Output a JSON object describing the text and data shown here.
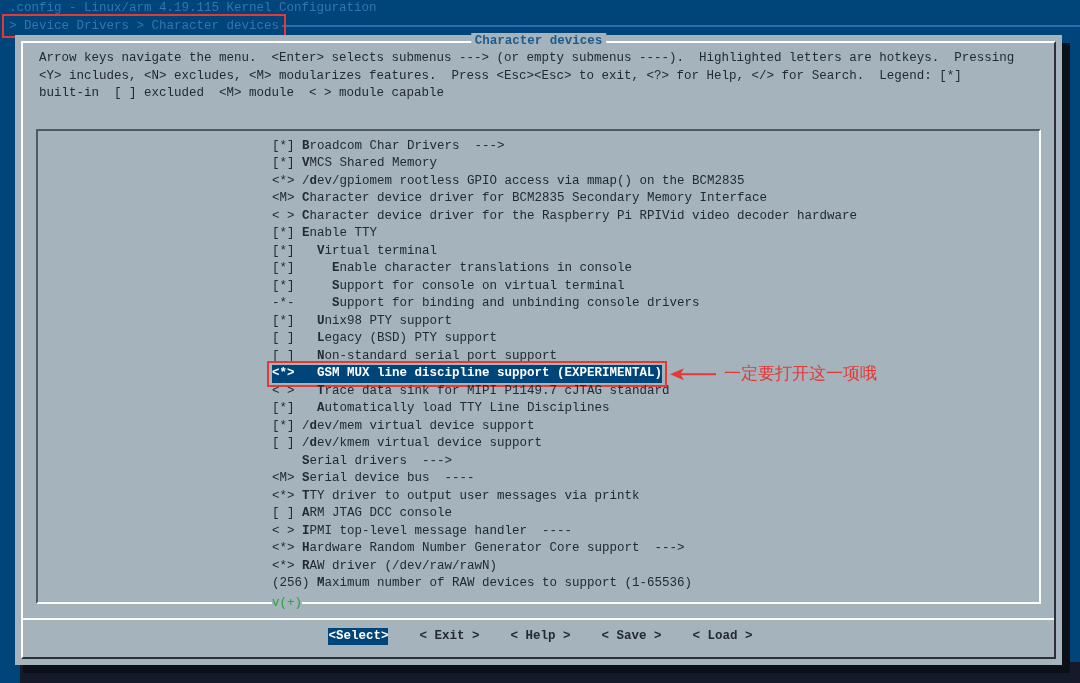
{
  "window": {
    "title": ".config - Linux/arm 4.19.115 Kernel Configuration"
  },
  "breadcrumb": "> Device Drivers > Character devices",
  "dialog": {
    "title": "Character devices",
    "help_lines": [
      "Arrow keys navigate the menu.  <Enter> selects submenus ---> (or empty submenus ----).  Highlighted letters are hotkeys.  Pressing",
      "<Y> includes, <N> excludes, <M> modularizes features.  Press <Esc><Esc> to exit, <?> for Help, </> for Search.  Legend: [*]",
      "built-in  [ ] excluded  <M> module  < > module capable"
    ],
    "items": [
      {
        "prefix": "[*]",
        "text": "**B**roadcom Char Drivers  --->",
        "selected": false
      },
      {
        "prefix": "[*]",
        "text": "**V**MCS Shared Memory",
        "selected": false
      },
      {
        "prefix": "<*>",
        "text": "/**d**ev/gpiomem rootless GPIO access via mmap() on the BCM2835",
        "selected": false
      },
      {
        "prefix": "<M>",
        "text": "**C**haracter device driver for BCM2835 Secondary Memory Interface",
        "selected": false
      },
      {
        "prefix": "< >",
        "text": "**C**haracter device driver for the Raspberry Pi RPIVid video decoder hardware",
        "selected": false
      },
      {
        "prefix": "[*]",
        "text": "**E**nable TTY",
        "selected": false,
        "children": [
          {
            "prefix": "[*]",
            "text": "**V**irtual terminal",
            "selected": false,
            "children": [
              {
                "prefix": "[*]",
                "text": "**E**nable character translations in console",
                "selected": false
              },
              {
                "prefix": "[*]",
                "text": "**S**upport for console on virtual terminal",
                "selected": false
              },
              {
                "prefix": "-*-",
                "text": "**S**upport for binding and unbinding console drivers",
                "selected": false
              }
            ]
          },
          {
            "prefix": "[*]",
            "text": "**U**nix98 PTY support",
            "selected": false
          },
          {
            "prefix": "[ ]",
            "text": "**L**egacy (BSD) PTY support",
            "selected": false
          },
          {
            "prefix": "[ ]",
            "text": "**N**on-standard serial port support",
            "selected": false
          },
          {
            "prefix": "<*>",
            "text": "**G**SM MUX line discipline support (EXPERIMENTAL)",
            "selected": true
          },
          {
            "prefix": "< >",
            "text": "**T**race data sink for MIPI P1149.7 cJTAG standard",
            "selected": false
          },
          {
            "prefix": "[*]",
            "text": "**A**utomatically load TTY Line Disciplines",
            "selected": false
          }
        ]
      },
      {
        "prefix": "[*]",
        "text": "/**d**ev/mem virtual device support",
        "selected": false
      },
      {
        "prefix": "[ ]",
        "text": "/**d**ev/kmem virtual device support",
        "selected": false
      },
      {
        "text": "**S**erial drivers  --->",
        "selected": false
      },
      {
        "prefix": "<M>",
        "text": "**S**erial device bus  ----",
        "selected": false
      },
      {
        "prefix": "<*>",
        "text": "**T**TY driver to output user messages via printk",
        "selected": false
      },
      {
        "prefix": "[ ]",
        "text": "**A**RM JTAG DCC console",
        "selected": false
      },
      {
        "prefix": "< >",
        "text": "**I**PMI top-level message handler  ----",
        "selected": false
      },
      {
        "prefix": "<*>",
        "text": "**H**ardware Random Number Generator Core support  --->",
        "selected": false
      },
      {
        "prefix": "<*>",
        "text": "**R**AW driver (/dev/raw/rawN)",
        "selected": false
      },
      {
        "prefix": "(256)",
        "text": "**M**aximum number of RAW devices to support (1-65536)",
        "selected": false
      }
    ],
    "scroll_indicator": "v(+)",
    "buttons": [
      {
        "label": "<**S**elect>",
        "selected": true
      },
      {
        "label": "< **E**xit >",
        "selected": false
      },
      {
        "label": "< **H**elp >",
        "selected": false
      },
      {
        "label": "< **S**ave >",
        "selected": false
      },
      {
        "label": "< **L**oad >",
        "selected": false
      }
    ]
  },
  "annotation": {
    "text": "一定要打开这一项哦"
  }
}
